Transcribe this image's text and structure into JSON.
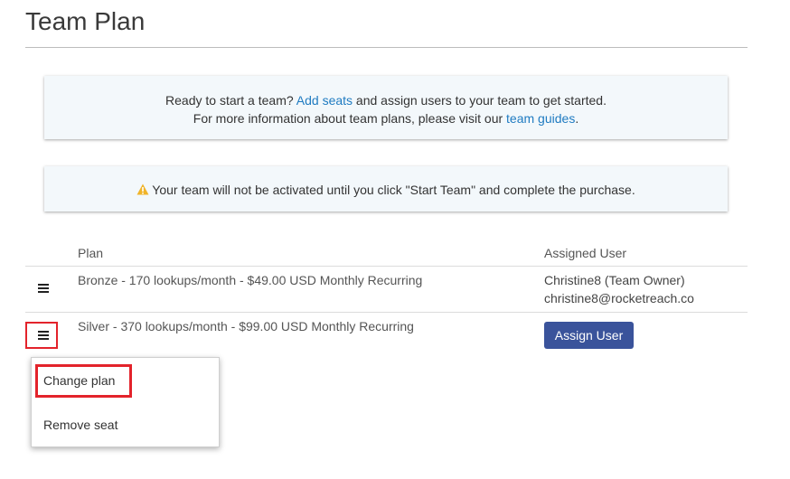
{
  "page": {
    "title": "Team Plan"
  },
  "notice_start": {
    "line1_before": "Ready to start a team? ",
    "line1_link": "Add seats",
    "line1_after": " and assign users to your team to get started.",
    "line2_before": "For more information about team plans, please visit our ",
    "line2_link": "team guides",
    "line2_after": "."
  },
  "notice_warning": {
    "icon": "warning-triangle-icon",
    "icon_color": "#f0b429",
    "text": "Your team will not be activated until you click \"Start Team\" and complete the purchase."
  },
  "table": {
    "headers": {
      "plan": "Plan",
      "assigned_user": "Assigned User"
    },
    "rows": [
      {
        "plan": "Bronze - 170 lookups/month - $49.00 USD Monthly Recurring",
        "user_name": "Christine8 (Team Owner)",
        "user_email": "christine8@rocketreach.co"
      },
      {
        "plan": "Silver - 370 lookups/month - $99.00 USD Monthly Recurring",
        "assign_label": "Assign User"
      }
    ]
  },
  "row_menu": {
    "items": [
      "Change plan",
      "Remove seat"
    ]
  },
  "colors": {
    "link": "#1f7bc1",
    "primary_button": "#3a539b",
    "highlight": "#e3232b",
    "notice_bg": "#f3f8fb"
  }
}
